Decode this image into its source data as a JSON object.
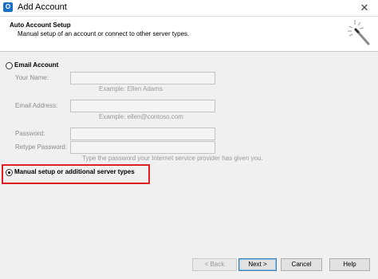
{
  "window": {
    "title": "Add Account",
    "close_glyph": "✕"
  },
  "header": {
    "title": "Auto Account Setup",
    "subtitle": "Manual setup of an account or connect to other server types."
  },
  "email_account": {
    "label": "Email Account",
    "selected": false,
    "fields": {
      "your_name": {
        "label": "Your Name:",
        "value": "",
        "example": "Example: Ellen Adams"
      },
      "email_address": {
        "label": "Email Address:",
        "value": "",
        "example": "Example: ellen@contoso.com"
      },
      "password": {
        "label": "Password:",
        "value": ""
      },
      "retype_password": {
        "label": "Retype Password:",
        "value": ""
      }
    },
    "password_hint": "Type the password your Internet service provider has given you."
  },
  "manual_setup": {
    "label": "Manual setup or additional server types",
    "selected": true
  },
  "buttons": {
    "back": "< Back",
    "next": "Next >",
    "cancel": "Cancel",
    "help": "Help"
  },
  "colors": {
    "highlight": "#e02020",
    "app_icon": "#1a6fc4"
  },
  "icons": {
    "app": "outlook-icon",
    "wizard": "wand-sparkle-icon",
    "close": "close-icon"
  }
}
